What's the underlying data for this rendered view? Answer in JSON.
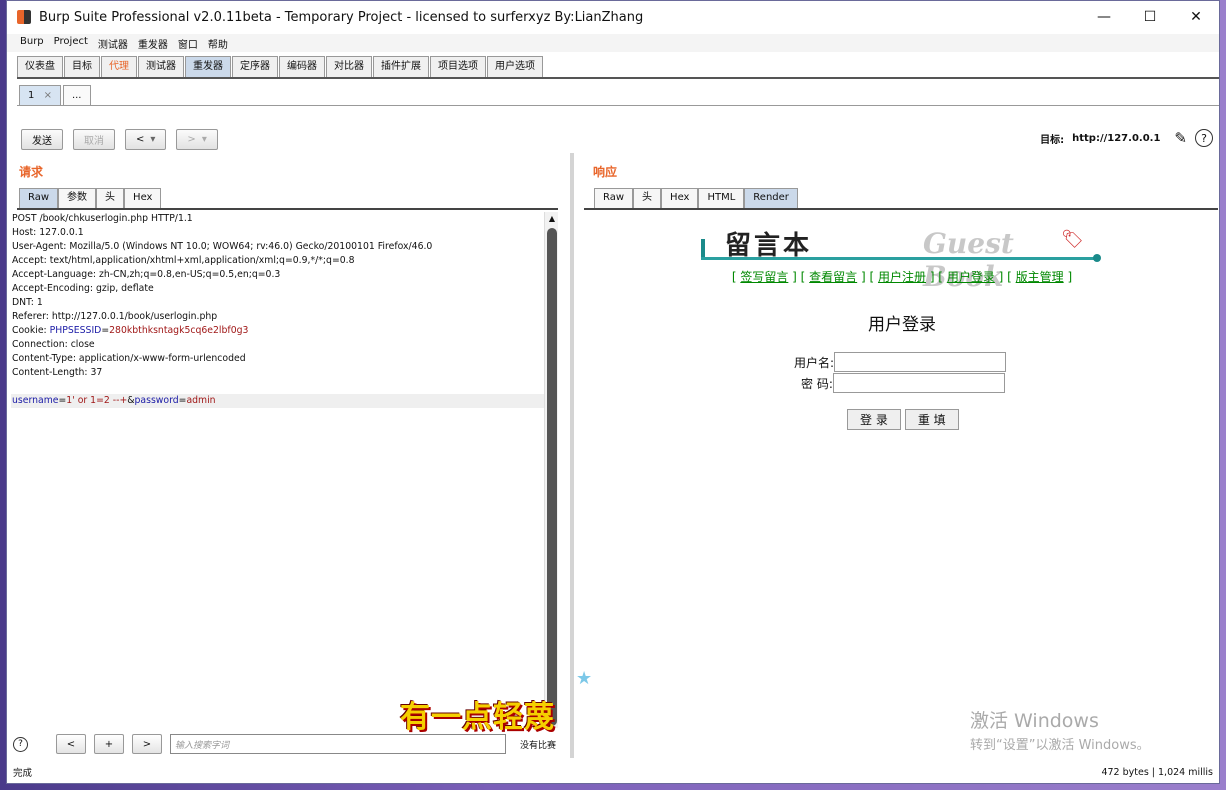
{
  "window": {
    "title": "Burp Suite Professional v2.0.11beta - Temporary Project - licensed to surferxyz By:LianZhang"
  },
  "menu": [
    "Burp",
    "Project",
    "测试器",
    "重发器",
    "窗口",
    "帮助"
  ],
  "main_tabs": [
    "仪表盘",
    "目标",
    "代理",
    "测试器",
    "重发器",
    "定序器",
    "编码器",
    "对比器",
    "插件扩展",
    "项目选项",
    "用户选项"
  ],
  "sub_tabs": {
    "first": "1",
    "close": "×",
    "more": "..."
  },
  "toolbar": {
    "send": "发送",
    "cancel": "取消",
    "back": "<",
    "forward": ">",
    "dropdown": "▾"
  },
  "target": {
    "label": "目标:",
    "value": "http://127.0.0.1"
  },
  "request": {
    "title": "请求",
    "tabs": [
      "Raw",
      "参数",
      "头",
      "Hex"
    ],
    "lines": [
      "POST /book/chkuserlogin.php HTTP/1.1",
      "Host: 127.0.0.1",
      "User-Agent: Mozilla/5.0 (Windows NT 10.0; WOW64; rv:46.0) Gecko/20100101 Firefox/46.0",
      "Accept: text/html,application/xhtml+xml,application/xml;q=0.9,*/*;q=0.8",
      "Accept-Language: zh-CN,zh;q=0.8,en-US;q=0.5,en;q=0.3",
      "Accept-Encoding: gzip, deflate",
      "DNT: 1",
      "Referer: http://127.0.0.1/book/userlogin.php"
    ],
    "cookie_prefix": "Cookie: ",
    "cookie_name": "PHPSESSID",
    "cookie_eq": "=",
    "cookie_value": "280kbthksntagk5cq6e2lbf0g3",
    "lines2": [
      "Connection: close",
      "Content-Type: application/x-www-form-urlencoded",
      "Content-Length: 37"
    ],
    "body": {
      "k1": "username",
      "v1": "1' or 1=2 --+",
      "amp": "&",
      "k2": "password",
      "v2": "admin",
      "eq": "="
    }
  },
  "search": {
    "help": "?",
    "prev": "<",
    "add": "+",
    "next": ">",
    "placeholder": "输入搜索字词",
    "matches": "没有比赛"
  },
  "response": {
    "title": "响应",
    "tabs": [
      "Raw",
      "头",
      "Hex",
      "HTML",
      "Render"
    ],
    "page": {
      "logo_cn": "留言本",
      "logo_en": "Guest Book",
      "nav": [
        "签写留言",
        "查看留言",
        "用户注册",
        "用户登录",
        "版主管理"
      ],
      "heading": "用户登录",
      "username_label": "用户名:",
      "password_label": "密 码:",
      "login_btn": "登 录",
      "reset_btn": "重 填"
    }
  },
  "status": {
    "left": "完成",
    "right": "472 bytes | 1,024 millis"
  },
  "overlay": {
    "text": "有一点轻蔑"
  },
  "watermark": {
    "line1": "激活 Windows",
    "line2": "转到“设置”以激活 Windows。"
  }
}
